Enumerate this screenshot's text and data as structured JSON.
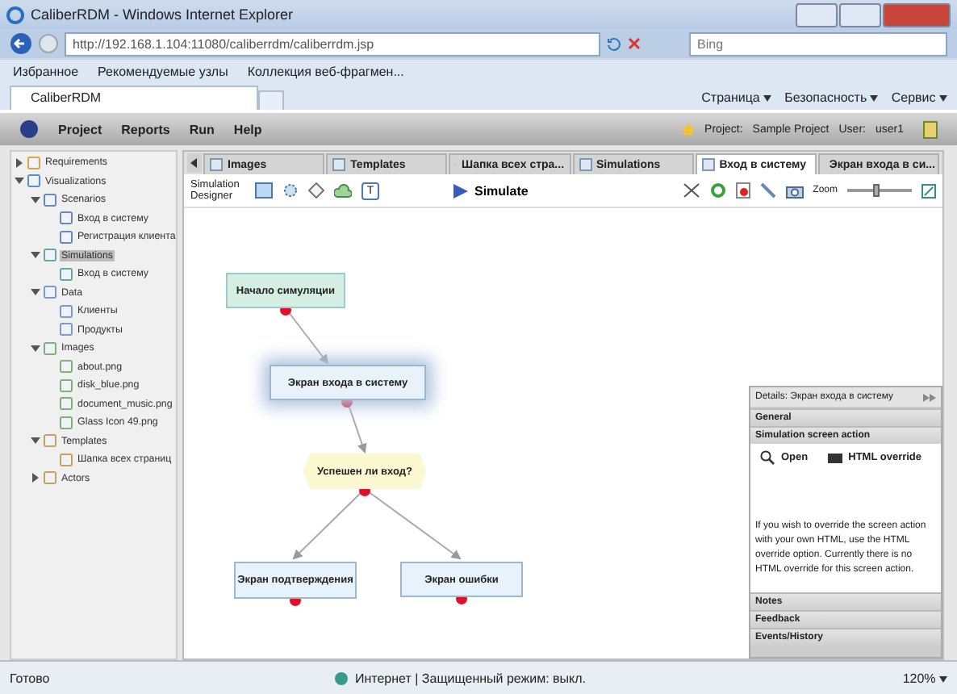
{
  "browser": {
    "title": "CaliberRDM - Windows Internet Explorer",
    "address": "http://192.168.1.104:11080/caliberrdm/caliberrdm.jsp",
    "search_placeholder": "Bing",
    "favorites": [
      "Избранное",
      "Рекомендуемые узлы",
      "Коллекция веб-фрагмен..."
    ],
    "tab": "CaliberRDM",
    "commands": [
      "Страница",
      "Безопасность",
      "Сервис"
    ]
  },
  "app": {
    "menu": [
      "Project",
      "Reports",
      "Run",
      "Help"
    ],
    "project_label": "Project:",
    "project": "Sample Project",
    "user_label": "User:",
    "user": "user1"
  },
  "tree": [
    {
      "label": "Requirements",
      "kind": "requirements",
      "expanded": false,
      "selected": false
    },
    {
      "label": "Visualizations",
      "kind": "visualizations",
      "expanded": true,
      "selected": false,
      "children": [
        {
          "label": "Scenarios",
          "kind": "scenario",
          "expanded": true,
          "selected": false,
          "children": [
            {
              "label": "Вход в систему",
              "kind": "scenario",
              "selected": false
            },
            {
              "label": "Регистрация клиента",
              "kind": "scenario",
              "selected": false
            }
          ]
        },
        {
          "label": "Simulations",
          "kind": "simulation",
          "expanded": true,
          "selected": true,
          "children": [
            {
              "label": "Вход в систему",
              "kind": "simulation",
              "selected": false
            }
          ]
        },
        {
          "label": "Data",
          "kind": "data",
          "expanded": true,
          "selected": false,
          "children": [
            {
              "label": "Клиенты",
              "kind": "data",
              "selected": false
            },
            {
              "label": "Продукты",
              "kind": "data",
              "selected": false
            }
          ]
        },
        {
          "label": "Images",
          "kind": "image",
          "expanded": true,
          "selected": false,
          "children": [
            {
              "label": "about.png",
              "kind": "image",
              "selected": false
            },
            {
              "label": "disk_blue.png",
              "kind": "image",
              "selected": false
            },
            {
              "label": "document_music.png",
              "kind": "image",
              "selected": false
            },
            {
              "label": "Glass Icon 49.png",
              "kind": "image",
              "selected": false
            }
          ]
        },
        {
          "label": "Templates",
          "kind": "template",
          "expanded": true,
          "selected": false,
          "children": [
            {
              "label": "Шапка всех страниц",
              "kind": "template",
              "selected": false
            }
          ]
        },
        {
          "label": "Actors",
          "kind": "template",
          "expanded": false,
          "selected": false
        }
      ]
    }
  ],
  "tabs": [
    {
      "label": "Images",
      "selected": false
    },
    {
      "label": "Templates",
      "selected": false
    },
    {
      "label": "Шапка всех стра...",
      "selected": false
    },
    {
      "label": "Simulations",
      "selected": false
    },
    {
      "label": "Вход в систему",
      "selected": true
    },
    {
      "label": "Экран входа в си...",
      "selected": false
    }
  ],
  "toolbar": {
    "designer_label": "Simulation Designer",
    "text_tool": "T",
    "simulate": "Simulate",
    "zoom_label": "Zoom",
    "zoom": {
      "level": 0.45
    }
  },
  "diagram": {
    "nodes": [
      {
        "kind": "start",
        "label": "Начало симуляции",
        "selected": false
      },
      {
        "kind": "screen",
        "label": "Экран входа в систему",
        "selected": true
      },
      {
        "kind": "decision",
        "label": "Успешен ли вход?",
        "selected": false
      },
      {
        "kind": "screen",
        "label": "Экран подтверждения",
        "selected": false
      },
      {
        "kind": "screen",
        "label": "Экран ошибки",
        "selected": false
      }
    ]
  },
  "details": {
    "title": "Details: Экран входа в систему",
    "sections_top": [
      "General",
      "Simulation screen action"
    ],
    "actions": [
      "Open",
      "HTML override"
    ],
    "description": "If you wish to override the screen action with your own HTML, use the HTML override option. Currently there is no HTML override for this screen action.",
    "sections_bottom": [
      "Notes",
      "Feedback",
      "Events/History"
    ]
  },
  "status_bar": {
    "text": "Готово",
    "zone": "Интернет | Защищенный режим: выкл.",
    "zoom": "120%"
  }
}
